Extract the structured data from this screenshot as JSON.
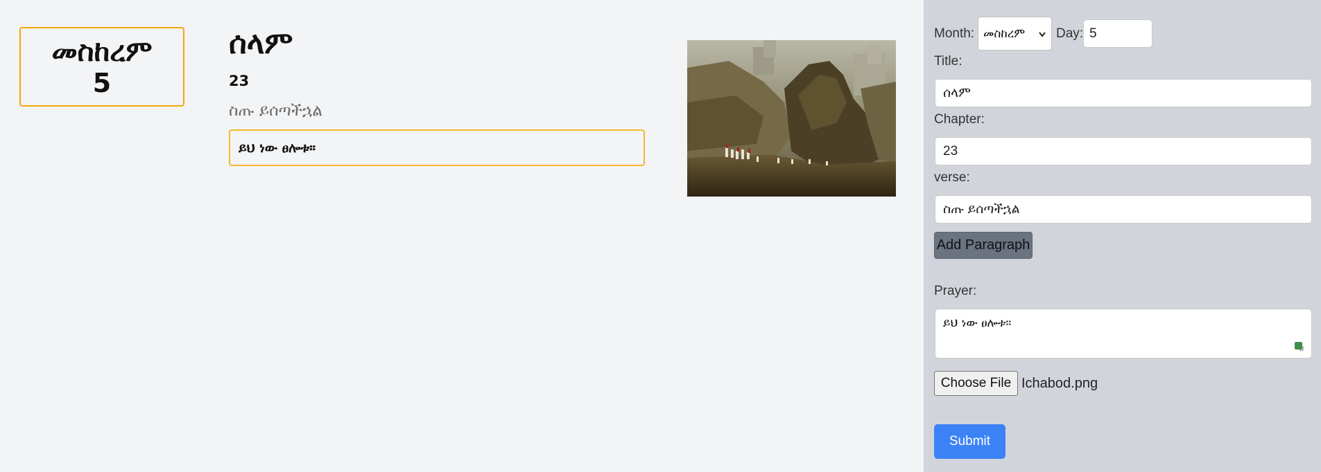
{
  "preview": {
    "month": "መስከረም",
    "day": "5",
    "title": "ሰላም",
    "chapter": "23",
    "verse": "ስጡ ይሰጣችኋል",
    "prayer": "ይህ ነው ፀሎቱ።",
    "image_icon": "painting-image"
  },
  "form": {
    "month_label": "Month:",
    "month_value": "መስከረም",
    "day_label": "Day:",
    "day_value": "5",
    "title_label": "Title:",
    "title_value": "ሰላም",
    "chapter_label": "Chapter:",
    "chapter_value": "23",
    "verse_label": "verse:",
    "verse_value": "ስጡ ይሰጣችኋል",
    "add_paragraph_label": "Add Paragraph",
    "prayer_label": "Prayer:",
    "prayer_value": "ይህ ነው ፀሎቱ።",
    "choose_file_label": "Choose File",
    "file_name": "Ichabod.png",
    "submit_label": "Submit"
  },
  "colors": {
    "preview_bg": "#f3f4f6",
    "panel_bg": "#d1d5db",
    "accent_border": "#f5a70c",
    "submit_blue": "#3b82f6",
    "button_grey": "#6b7280"
  }
}
